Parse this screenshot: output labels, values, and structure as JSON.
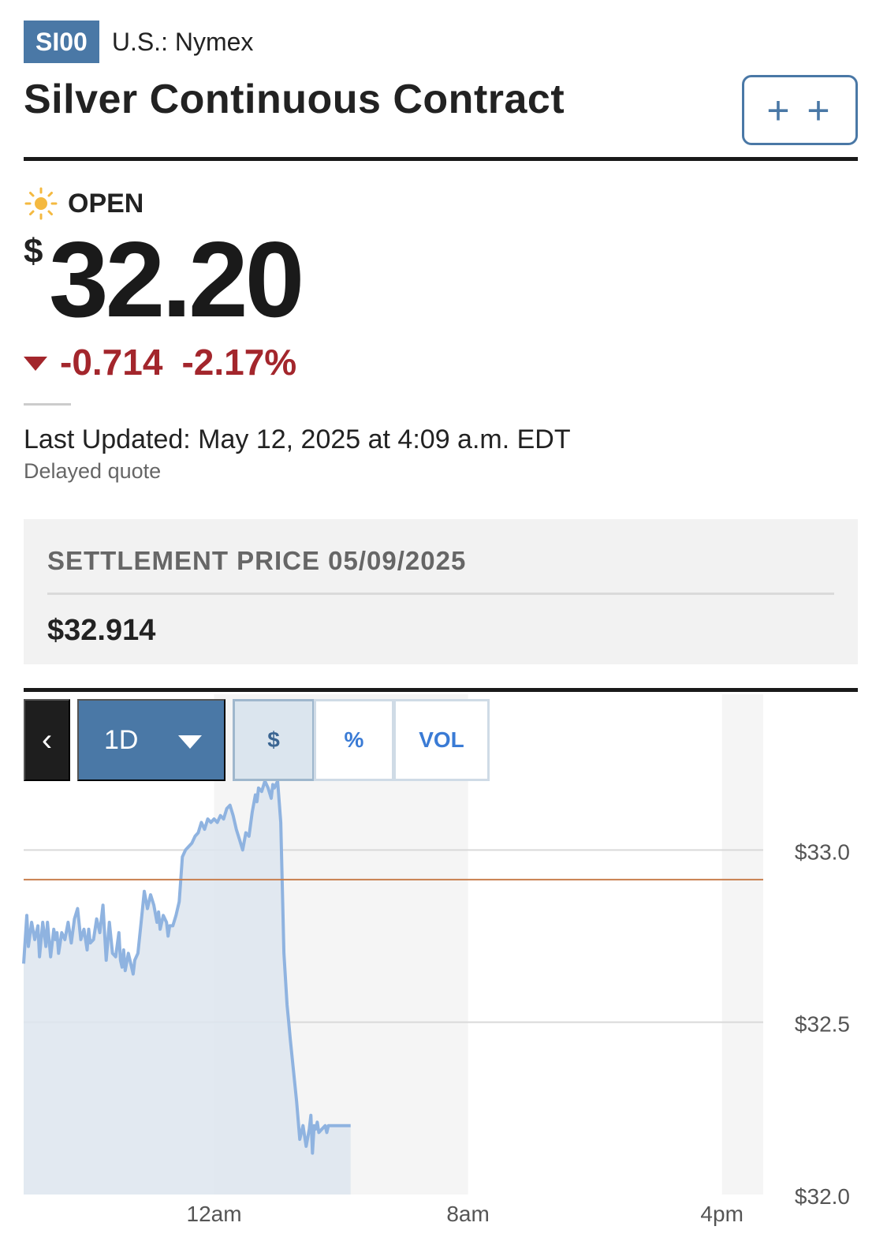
{
  "header": {
    "ticker": "SI00",
    "exchange": "U.S.: Nymex",
    "title": "Silver Continuous Contract",
    "watch_button_label": "+ +"
  },
  "quote": {
    "status": "OPEN",
    "status_icon": "sun-icon",
    "currency_symbol": "$",
    "price": "32.20",
    "change": "-0.714",
    "change_percent": "-2.17%",
    "direction_icon": "down-triangle-icon",
    "last_updated": "Last Updated: May 12, 2025 at 4:09 a.m. EDT",
    "delayed_note": "Delayed quote"
  },
  "settlement": {
    "label": "SETTLEMENT PRICE 05/09/2025",
    "value": "$32.914"
  },
  "chart_controls": {
    "back_icon": "chevron-left-icon",
    "back_glyph": "‹",
    "range_label": "1D",
    "range_icon": "caret-down-icon",
    "modes": [
      "$",
      "%",
      "VOL"
    ],
    "active_mode": "$"
  },
  "colors": {
    "accent": "#4a78a6",
    "negative": "#a3262c",
    "line": "#8fb3e0",
    "fill": "#dde5ef",
    "settlement_line": "#c87f4e",
    "session_shade": "#f5f5f5"
  },
  "chart_data": {
    "type": "area",
    "ylim": [
      32.0,
      33.2
    ],
    "y_ticks": [
      33.0,
      32.5,
      32.0
    ],
    "y_tick_labels": [
      "$33.0",
      "$32.5",
      "$32.0"
    ],
    "x_tick_labels": [
      "12am",
      "8am",
      "4pm"
    ],
    "x_ticks_hours": [
      6,
      14,
      22
    ],
    "x_range_hours": [
      0,
      23.3
    ],
    "settlement_price": 32.914,
    "grid": true,
    "series": [
      {
        "x": [
          0,
          0.1,
          0.15,
          0.25,
          0.35,
          0.45,
          0.5,
          0.6,
          0.7,
          0.75,
          0.85,
          0.95,
          1.0,
          1.05,
          1.1,
          1.2,
          1.3,
          1.4,
          1.5,
          1.6,
          1.7,
          1.8,
          1.9,
          2.0,
          2.05,
          2.1,
          2.2,
          2.3,
          2.4,
          2.5,
          2.6,
          2.7,
          2.8,
          2.9,
          3.0,
          3.05,
          3.1,
          3.15,
          3.2,
          3.3,
          3.4,
          3.45,
          3.5,
          3.6,
          3.7,
          3.8,
          3.9,
          4.0,
          4.1,
          4.2,
          4.25,
          4.3,
          4.4,
          4.5,
          4.55,
          4.6,
          4.7,
          4.8,
          4.9,
          5.0,
          5.1,
          5.2,
          5.3,
          5.4,
          5.5,
          5.6,
          5.7,
          5.8,
          5.9,
          6.0,
          6.1,
          6.2,
          6.3,
          6.4,
          6.5,
          6.6,
          6.7,
          6.8,
          6.9,
          7.0,
          7.1,
          7.2,
          7.3,
          7.35,
          7.4,
          7.5,
          7.6,
          7.7,
          7.8,
          7.85,
          7.9,
          8.0,
          8.05,
          8.1,
          8.2,
          8.3,
          8.35,
          8.4,
          8.5,
          8.6,
          8.7,
          8.8,
          8.9,
          9.0,
          9.05,
          9.1,
          9.15,
          9.2,
          9.25,
          9.3,
          9.4,
          9.5,
          9.55,
          9.6,
          9.7,
          9.8,
          9.9,
          9.95,
          10.0,
          10.05,
          10.1,
          10.15,
          10.2,
          10.3
        ],
        "values": [
          32.67,
          32.81,
          32.72,
          32.79,
          32.74,
          32.78,
          32.69,
          32.79,
          32.72,
          32.79,
          32.69,
          32.77,
          32.74,
          32.76,
          32.7,
          32.76,
          32.74,
          32.79,
          32.73,
          32.8,
          32.83,
          32.74,
          32.77,
          32.71,
          32.77,
          32.73,
          32.74,
          32.8,
          32.76,
          32.84,
          32.68,
          32.79,
          32.7,
          32.69,
          32.76,
          32.68,
          32.66,
          32.71,
          32.65,
          32.7,
          32.66,
          32.64,
          32.68,
          32.7,
          32.79,
          32.88,
          32.83,
          32.87,
          32.84,
          32.79,
          32.82,
          32.77,
          32.81,
          32.79,
          32.75,
          32.78,
          32.78,
          32.81,
          32.85,
          32.98,
          33.0,
          33.01,
          33.02,
          33.04,
          33.05,
          33.08,
          33.06,
          33.09,
          33.08,
          33.09,
          33.08,
          33.1,
          33.09,
          33.12,
          33.13,
          33.1,
          33.06,
          33.03,
          33.0,
          33.05,
          33.04,
          33.11,
          33.16,
          33.14,
          33.18,
          33.17,
          33.2,
          33.18,
          33.15,
          33.19,
          33.18,
          33.2,
          33.14,
          33.08,
          32.7,
          32.55,
          32.5,
          32.45,
          32.36,
          32.27,
          32.16,
          32.2,
          32.14,
          32.19,
          32.23,
          32.12,
          32.2,
          32.19,
          32.21,
          32.18,
          32.19,
          32.2,
          32.18,
          32.2,
          32.2,
          32.2,
          32.2,
          32.2,
          32.2,
          32.2,
          32.2,
          32.2,
          32.2,
          32.2
        ]
      }
    ]
  }
}
